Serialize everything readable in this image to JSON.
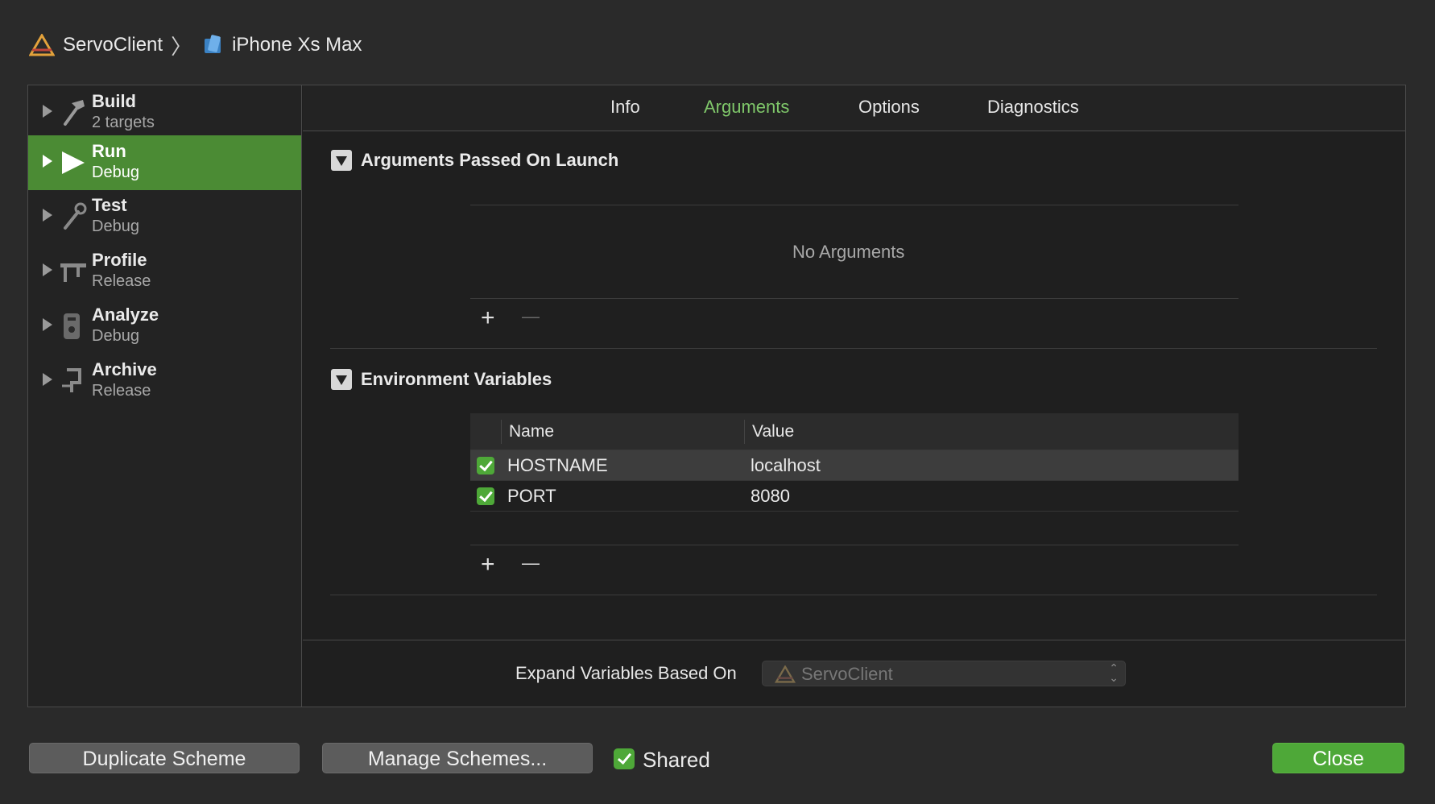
{
  "breadcrumb": {
    "project": "ServoClient",
    "device": "iPhone Xs Max"
  },
  "sidebar": {
    "items": [
      {
        "title": "Build",
        "subtitle": "2 targets",
        "icon": "hammer-icon"
      },
      {
        "title": "Run",
        "subtitle": "Debug",
        "icon": "play-icon",
        "selected": true
      },
      {
        "title": "Test",
        "subtitle": "Debug",
        "icon": "wrench-icon"
      },
      {
        "title": "Profile",
        "subtitle": "Release",
        "icon": "caliper-icon"
      },
      {
        "title": "Analyze",
        "subtitle": "Debug",
        "icon": "analyze-icon"
      },
      {
        "title": "Archive",
        "subtitle": "Release",
        "icon": "archive-icon"
      }
    ]
  },
  "tabs": [
    {
      "label": "Info"
    },
    {
      "label": "Arguments",
      "active": true
    },
    {
      "label": "Options"
    },
    {
      "label": "Diagnostics"
    }
  ],
  "arguments": {
    "title": "Arguments Passed On Launch",
    "empty_text": "No Arguments",
    "add_label": "+",
    "remove_label": "—"
  },
  "environment": {
    "title": "Environment Variables",
    "columns": [
      "Name",
      "Value"
    ],
    "rows": [
      {
        "name": "HOSTNAME",
        "value": "localhost",
        "enabled": true
      },
      {
        "name": "PORT",
        "value": "8080",
        "enabled": true
      }
    ],
    "add_label": "+",
    "remove_label": "—"
  },
  "expand": {
    "label": "Expand Variables Based On",
    "value": "ServoClient"
  },
  "footer": {
    "duplicate_label": "Duplicate Scheme",
    "manage_label": "Manage Schemes...",
    "shared_label": "Shared",
    "close_label": "Close"
  },
  "colors": {
    "accent": "#4ea838",
    "active_tab": "#7fc76a",
    "background": "#2a2a2a"
  }
}
